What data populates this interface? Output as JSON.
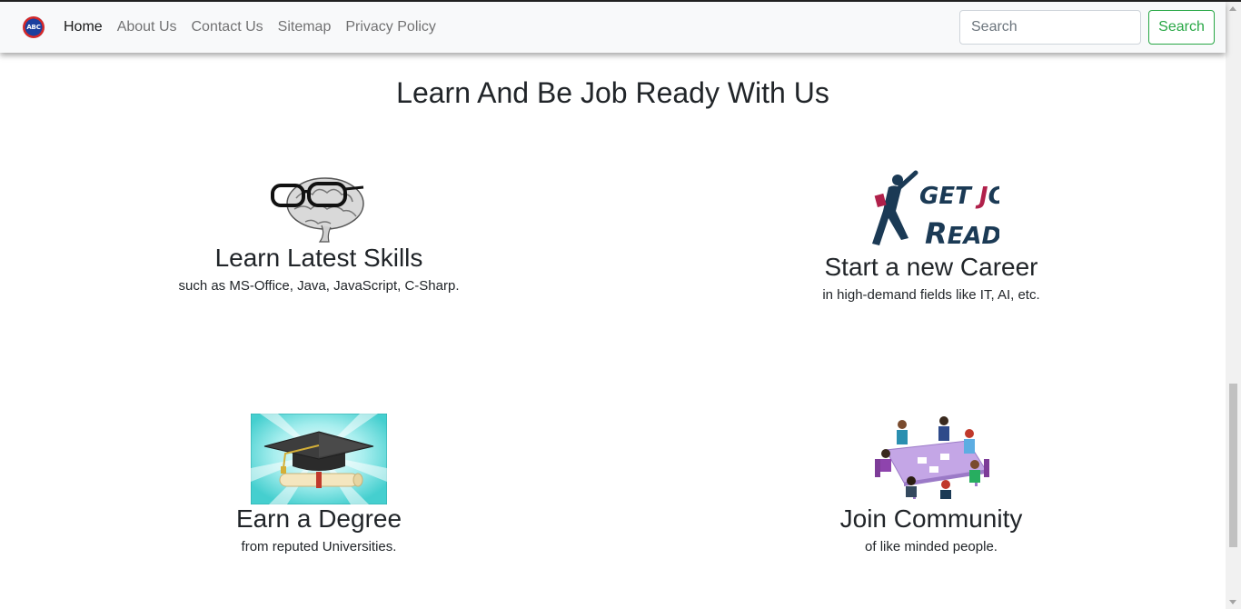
{
  "navbar": {
    "logo_text": "ABC",
    "links": [
      "Home",
      "About Us",
      "Contact Us",
      "Sitemap",
      "Privacy Policy"
    ],
    "active_link": "Home",
    "search_placeholder": "Search",
    "search_button": "Search"
  },
  "main": {
    "title": "Learn And Be Job Ready With Us",
    "features": [
      {
        "heading": "Learn Latest Skills",
        "text": "such as MS-Office, Java, JavaScript, C-Sharp.",
        "icon": "brain-with-glasses-icon"
      },
      {
        "heading": "Start a new Career",
        "text": "in high-demand fields like IT, AI, etc.",
        "icon": "get-job-ready-logo",
        "logo_text_1": "GET JOB",
        "logo_text_2": "READY"
      },
      {
        "heading": "Earn a Degree",
        "text": "from reputed Universities.",
        "icon": "graduation-cap-icon"
      },
      {
        "heading": "Join Community",
        "text": "of like minded people.",
        "icon": "community-meeting-icon"
      }
    ]
  },
  "colors": {
    "search_button": "#28a745",
    "navbar_bg": "#f8f9fa",
    "degree_bg": "#7fe0e0",
    "community_table": "#c4a6e6",
    "job_logo_red": "#b0204a",
    "job_logo_navy": "#1b3a55"
  }
}
